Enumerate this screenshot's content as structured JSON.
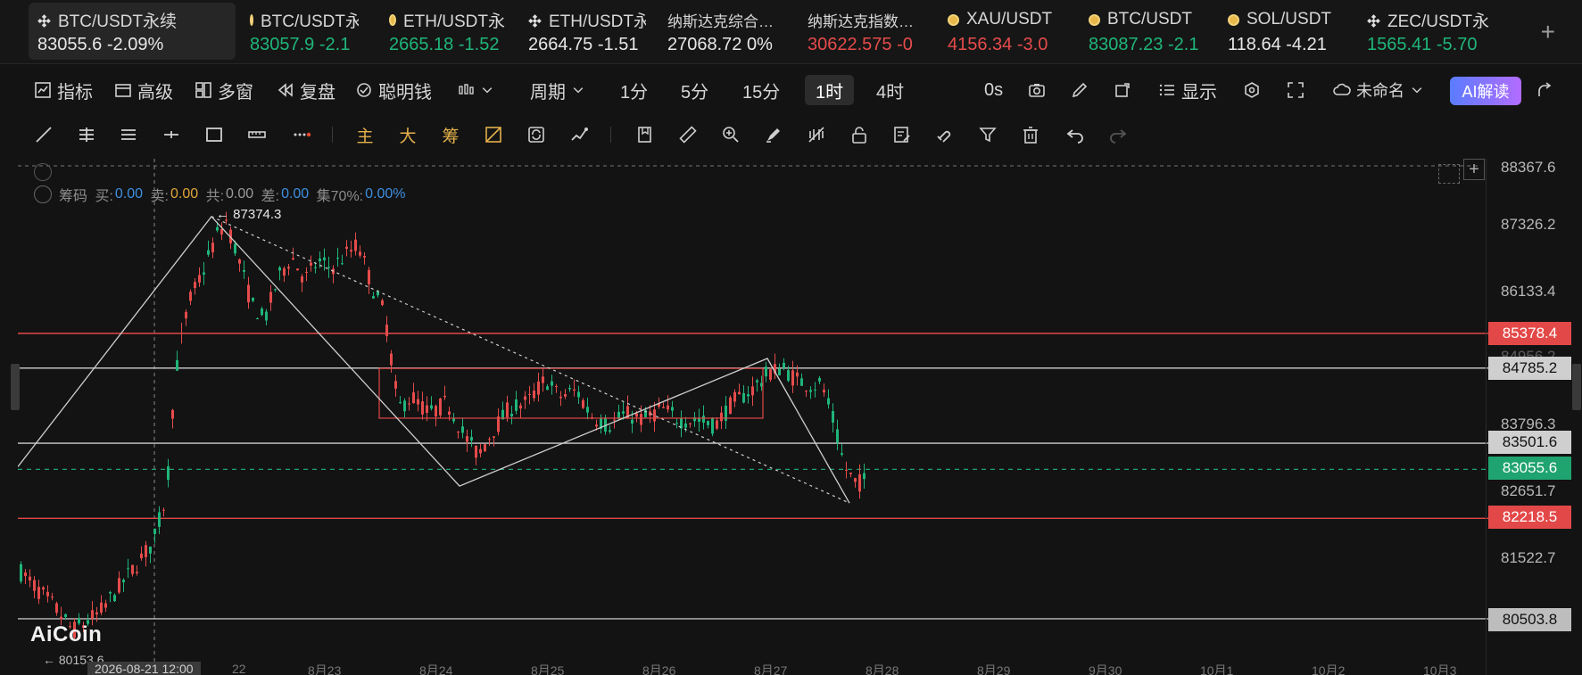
{
  "tickers": [
    {
      "symbol": "BTC/USDT永续",
      "price": "83055.6",
      "change": "-2.09%",
      "icon": "binance-icon",
      "price_color": "white"
    },
    {
      "symbol": "BTC/USDT永",
      "price": "83057.9",
      "change": "-2.1",
      "icon": "coin-icon",
      "price_color": "green"
    },
    {
      "symbol": "ETH/USDT永",
      "price": "2665.18",
      "change": "-1.52",
      "icon": "coin-icon",
      "price_color": "green"
    },
    {
      "symbol": "ETH/USDT永",
      "price": "2664.75",
      "change": "-1.51",
      "icon": "binance-icon",
      "price_color": "white"
    },
    {
      "symbol": "纳斯达克综合…",
      "price": "27068.72",
      "change": "0%",
      "icon": "",
      "price_color": "white"
    },
    {
      "symbol": "纳斯达克指数…",
      "price": "30622.575",
      "change": "-0",
      "icon": "",
      "price_color": "red"
    },
    {
      "symbol": "XAU/USDT",
      "price": "4156.34",
      "change": "-3.0",
      "icon": "coin-icon",
      "price_color": "red"
    },
    {
      "symbol": "BTC/USDT",
      "price": "83087.23",
      "change": "-2.1",
      "icon": "coin-icon",
      "price_color": "green"
    },
    {
      "symbol": "SOL/USDT",
      "price": "118.64",
      "change": "-4.21",
      "icon": "coin-icon",
      "price_color": "white"
    },
    {
      "symbol": "ZEC/USDT永",
      "price": "1565.41",
      "change": "-5.70",
      "icon": "binance-icon",
      "price_color": "green"
    }
  ],
  "toolbar1": {
    "indicators": "指标",
    "advanced": "高级",
    "multi_window": "多窗",
    "replay": "复盘",
    "smart_money": "聪明钱",
    "period": "周期",
    "intervals": [
      "1分",
      "5分",
      "15分",
      "1时",
      "4时"
    ],
    "selected_interval": "1时",
    "countdown": "0s",
    "display": "显示",
    "layout_name": "未命名",
    "ai_button": "AI解读"
  },
  "toolbar2": {
    "main": "主",
    "big": "大",
    "chips": "筹"
  },
  "indicator_legend": {
    "name": "筹码",
    "buy_label": "买:",
    "buy_value": "0.00",
    "sell_label": "卖:",
    "sell_value": "0.00",
    "total_label": "共:",
    "total_value": "0.00",
    "diff_label": "差:",
    "diff_value": "0.00",
    "concentration_label": "集70%:",
    "concentration_value": "0.00%"
  },
  "price_axis": {
    "labels": [
      "88367.6",
      "87326.2",
      "86133.4",
      "84956.2",
      "83796.3",
      "82651.7",
      "81522.7"
    ],
    "lines": [
      {
        "value": "85378.4",
        "color": "red"
      },
      {
        "value": "84785.2",
        "color": "white"
      },
      {
        "value": "83501.6",
        "color": "white"
      },
      {
        "value": "83055.6",
        "color": "green"
      },
      {
        "value": "82218.5",
        "color": "red"
      },
      {
        "value": "80503.8",
        "color": "gray"
      }
    ]
  },
  "annotations": {
    "high_label": "87374.3",
    "low_label": "80153.6"
  },
  "x_axis": {
    "crosshair_date": "2026-08-21 12:00",
    "dates": [
      "22",
      "8月23",
      "8月24",
      "8月25",
      "8月26",
      "8月27",
      "8月28",
      "8月29",
      "9月30",
      "10月1",
      "10月2",
      "10月3"
    ]
  },
  "logo": "AiCoin",
  "colors": {
    "up": "#1fb57a",
    "down": "#e54b4b",
    "background": "#131313",
    "accent": "#5a7cff"
  },
  "chart_data": {
    "type": "candlestick",
    "symbol": "BTC/USDT永续",
    "interval": "1时",
    "ylim": [
      80153.6,
      88367.6
    ],
    "last_price": 83055.6,
    "high": 87374.3,
    "horizontal_levels": [
      85378.4,
      84785.2,
      83501.6,
      83055.6,
      82218.5,
      80503.8
    ]
  }
}
